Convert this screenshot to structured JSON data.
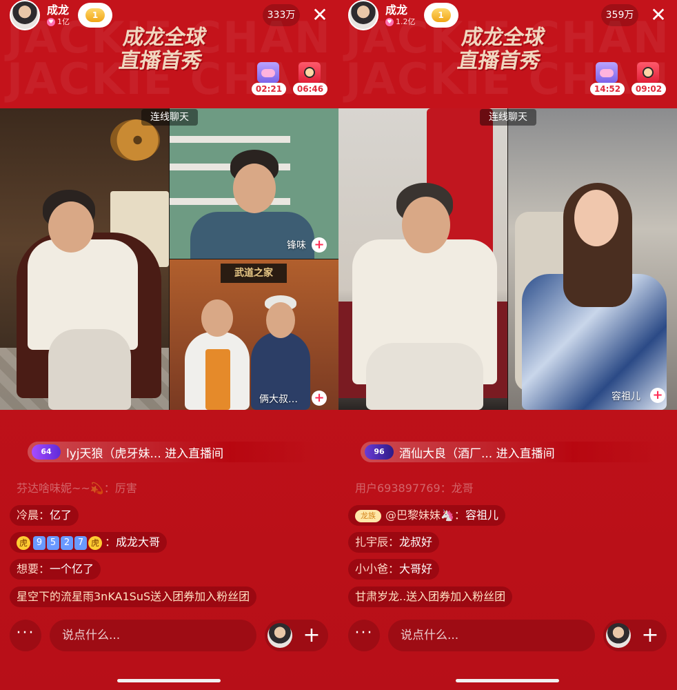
{
  "left": {
    "host": {
      "name": "成龙",
      "likes": "1亿",
      "badge": "1"
    },
    "viewers": "333万",
    "close_icon": "✕",
    "banner": {
      "bg_text": "JACKIE CHAN",
      "title_line1": "成龙全球",
      "title_line2": "直播首秀"
    },
    "tasks": [
      {
        "time": "02:21"
      },
      {
        "time": "06:46"
      }
    ],
    "link_label": "连线聊天",
    "tiles": {
      "guest1_name": "锋味",
      "guest2_name": "俩大叔…",
      "plaque": "武道之家"
    },
    "entry": {
      "level": "64",
      "text": "lyj天狼（虎牙妹... 进入直播间"
    },
    "messages": [
      {
        "name": "芬达啥味妮~~💫：",
        "text": "厉害",
        "faded": true
      },
      {
        "name": "冷晨：",
        "text": "亿了"
      },
      {
        "digits": [
          "9",
          "5",
          "2",
          "7"
        ],
        "name": "：",
        "text": "成龙大哥"
      },
      {
        "name": "想要：",
        "text": "一个亿了"
      },
      {
        "name": "",
        "text": "星空下的流星雨3nKA1SuS送入团券加入粉丝团"
      }
    ],
    "input_placeholder": "说点什么...",
    "more_label": "···",
    "plus_label": "+"
  },
  "right": {
    "host": {
      "name": "成龙",
      "likes": "1.2亿",
      "badge": "1"
    },
    "viewers": "359万",
    "close_icon": "✕",
    "banner": {
      "bg_text": "JACKIE CHAN",
      "title_line1": "成龙全球",
      "title_line2": "直播首秀"
    },
    "tasks": [
      {
        "time": "14:52"
      },
      {
        "time": "09:02"
      }
    ],
    "link_label": "连线聊天",
    "tiles": {
      "guest1_name": "容祖儿"
    },
    "entry": {
      "level": "96",
      "text": "酒仙大良（酒厂... 进入直播间"
    },
    "messages": [
      {
        "name": "用户693897769：",
        "text": "龙哥",
        "faded": true
      },
      {
        "tag": "龙族",
        "name": "@巴黎妹妹🦄：",
        "text": "容祖儿"
      },
      {
        "name": "扎宇辰：",
        "text": "龙叔好"
      },
      {
        "name": "小小爸：",
        "text": "大哥好"
      },
      {
        "name": "",
        "text": "甘肃岁龙..送入团券加入粉丝团"
      }
    ],
    "input_placeholder": "说点什么...",
    "more_label": "···",
    "plus_label": "+"
  },
  "colors": {
    "background": "#c4131b",
    "accent_pink": "#ff2d55",
    "level_purple": "#7b4cf0"
  }
}
